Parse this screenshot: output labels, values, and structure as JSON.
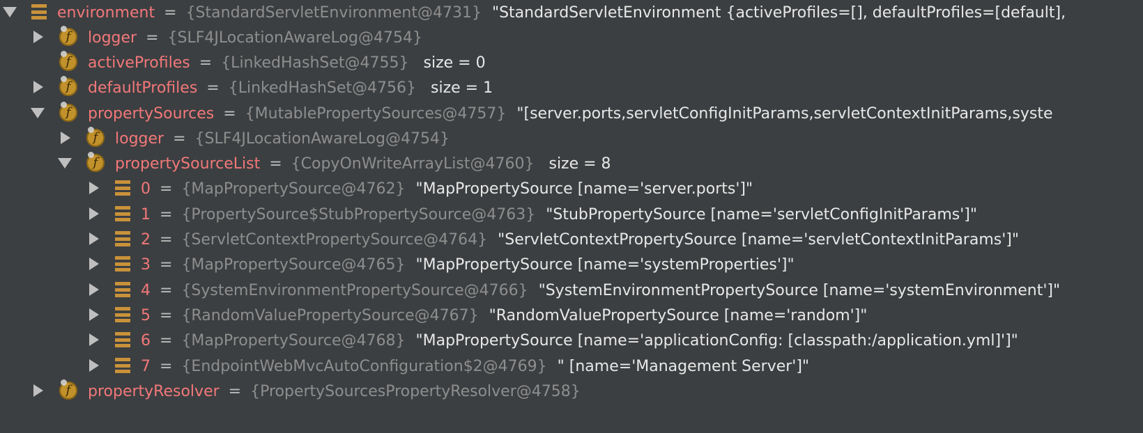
{
  "colors": {
    "background": "#3c3f41",
    "name": "#f2787a",
    "reference": "#8e8e8e",
    "value": "#e8e8e8",
    "field_icon": "#c1912b"
  },
  "rows": [
    {
      "state": "expanded",
      "icon": "list-icon",
      "name": "environment",
      "eq": "=",
      "ref": "{StandardServletEnvironment@4731}",
      "value": "\"StandardServletEnvironment {activeProfiles=[], defaultProfiles=[default],",
      "size": ""
    },
    {
      "state": "collapsed",
      "icon": "field-icon",
      "icon_glyph": "f",
      "name": "logger",
      "eq": "=",
      "ref": "{SLF4JLocationAwareLog@4754}",
      "value": "",
      "size": ""
    },
    {
      "state": "none",
      "icon": "field-icon",
      "icon_glyph": "f",
      "name": "activeProfiles",
      "eq": "=",
      "ref": "{LinkedHashSet@4755}",
      "value": "",
      "size": "size = 0"
    },
    {
      "state": "collapsed",
      "icon": "field-icon",
      "icon_glyph": "f",
      "name": "defaultProfiles",
      "eq": "=",
      "ref": "{LinkedHashSet@4756}",
      "value": "",
      "size": "size = 1"
    },
    {
      "state": "expanded",
      "icon": "field-icon",
      "icon_glyph": "f",
      "name": "propertySources",
      "eq": "=",
      "ref": "{MutablePropertySources@4757}",
      "value": "\"[server.ports,servletConfigInitParams,servletContextInitParams,syste",
      "size": ""
    },
    {
      "state": "collapsed",
      "icon": "field-icon",
      "icon_glyph": "f",
      "name": "logger",
      "eq": "=",
      "ref": "{SLF4JLocationAwareLog@4754}",
      "value": "",
      "size": ""
    },
    {
      "state": "expanded",
      "icon": "field-icon",
      "icon_glyph": "f",
      "name": "propertySourceList",
      "eq": "=",
      "ref": "{CopyOnWriteArrayList@4760}",
      "value": "",
      "size": "size = 8"
    },
    {
      "state": "collapsed",
      "icon": "list-icon",
      "name": "0",
      "eq": "=",
      "ref": "{MapPropertySource@4762}",
      "value": "\"MapPropertySource [name='server.ports']\"",
      "size": ""
    },
    {
      "state": "collapsed",
      "icon": "list-icon",
      "name": "1",
      "eq": "=",
      "ref": "{PropertySource$StubPropertySource@4763}",
      "value": "\"StubPropertySource [name='servletConfigInitParams']\"",
      "size": ""
    },
    {
      "state": "collapsed",
      "icon": "list-icon",
      "name": "2",
      "eq": "=",
      "ref": "{ServletContextPropertySource@4764}",
      "value": "\"ServletContextPropertySource [name='servletContextInitParams']\"",
      "size": ""
    },
    {
      "state": "collapsed",
      "icon": "list-icon",
      "name": "3",
      "eq": "=",
      "ref": "{MapPropertySource@4765}",
      "value": "\"MapPropertySource [name='systemProperties']\"",
      "size": ""
    },
    {
      "state": "collapsed",
      "icon": "list-icon",
      "name": "4",
      "eq": "=",
      "ref": "{SystemEnvironmentPropertySource@4766}",
      "value": "\"SystemEnvironmentPropertySource [name='systemEnvironment']\"",
      "size": ""
    },
    {
      "state": "collapsed",
      "icon": "list-icon",
      "name": "5",
      "eq": "=",
      "ref": "{RandomValuePropertySource@4767}",
      "value": "\"RandomValuePropertySource [name='random']\"",
      "size": ""
    },
    {
      "state": "collapsed",
      "icon": "list-icon",
      "name": "6",
      "eq": "=",
      "ref": "{MapPropertySource@4768}",
      "value": "\"MapPropertySource [name='applicationConfig: [classpath:/application.yml]']\"",
      "size": ""
    },
    {
      "state": "collapsed",
      "icon": "list-icon",
      "name": "7",
      "eq": "=",
      "ref": "{EndpointWebMvcAutoConfiguration$2@4769}",
      "value": "\" [name='Management Server']\"",
      "size": ""
    },
    {
      "state": "collapsed",
      "icon": "field-icon",
      "icon_glyph": "f",
      "name": "propertyResolver",
      "eq": "=",
      "ref": "{PropertySourcesPropertyResolver@4758}",
      "value": "",
      "size": ""
    }
  ]
}
